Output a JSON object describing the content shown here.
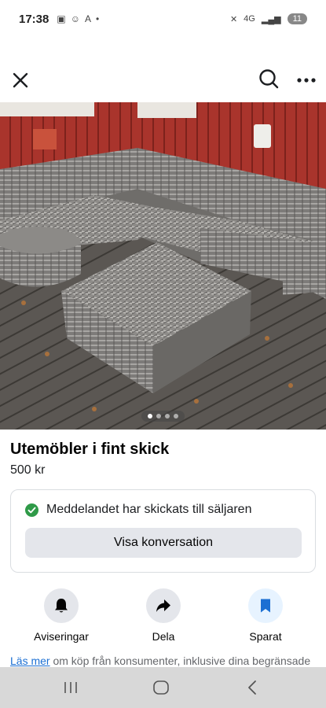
{
  "status_bar": {
    "time": "17:38",
    "network": "4G",
    "battery": "11"
  },
  "listing": {
    "title": "Utemöbler i fint skick",
    "price": "500 kr",
    "photo_count": 4,
    "photo_index": 1
  },
  "message": {
    "sent_text": "Meddelandet har skickats till säljaren",
    "conversation_button": "Visa konversation"
  },
  "actions": [
    {
      "label": "Aviseringar",
      "icon": "bell-icon"
    },
    {
      "label": "Dela",
      "icon": "share-icon"
    },
    {
      "label": "Sparat",
      "icon": "bookmark-icon"
    }
  ],
  "footer": {
    "link": "Läs mer",
    "text": "om köp från konsumenter, inklusive dina begränsade"
  },
  "colors": {
    "accent": "#1b6fd3",
    "success": "#2f9a48",
    "button_gray": "#e4e6eb"
  }
}
